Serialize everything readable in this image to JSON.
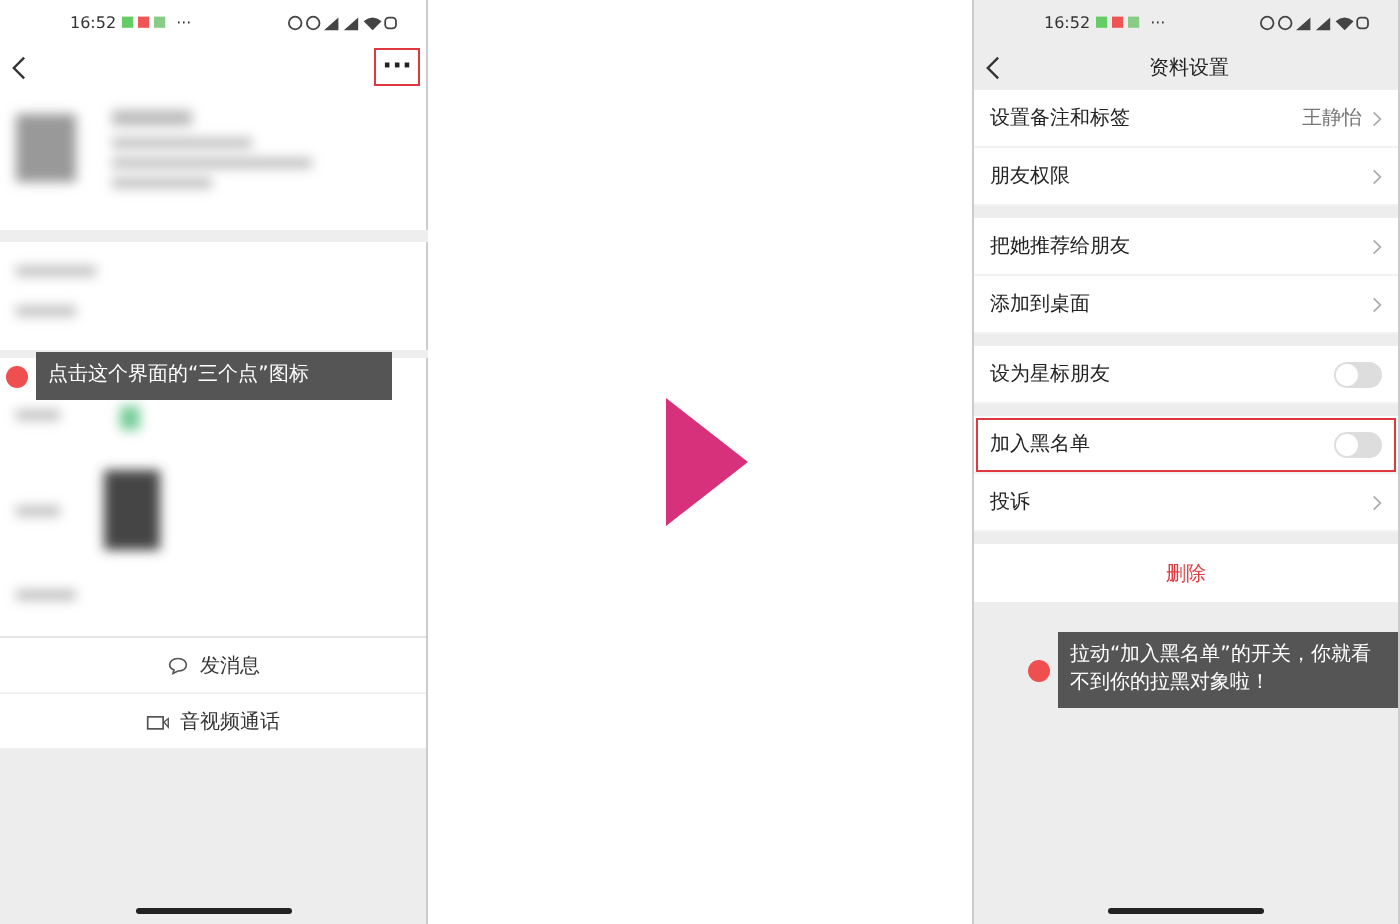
{
  "left_phone": {
    "status_bar": {
      "time": "16:52",
      "more": "···"
    },
    "more_button": {
      "label": "···",
      "highlighted": true
    },
    "tip": {
      "text": "点击这个界面的“三个点”图标"
    },
    "actions": [
      {
        "label": "发消息",
        "kind": "message"
      },
      {
        "label": "音视频通话",
        "kind": "video"
      }
    ]
  },
  "right_phone": {
    "status_bar": {
      "time": "16:52",
      "more": "···"
    },
    "title": "资料设置",
    "groups": [
      [
        {
          "label": "设置备注和标签",
          "kind": "link",
          "value": "王静怡",
          "highlighted": false
        },
        {
          "label": "朋友权限",
          "kind": "link",
          "highlighted": false
        }
      ],
      [
        {
          "label": "把她推荐给朋友",
          "kind": "link",
          "highlighted": false
        },
        {
          "label": "添加到桌面",
          "kind": "link",
          "highlighted": false
        }
      ],
      [
        {
          "label": "设为星标朋友",
          "kind": "toggle",
          "on": false,
          "highlighted": false
        }
      ],
      [
        {
          "label": "加入黑名单",
          "kind": "toggle",
          "on": false,
          "highlighted": true
        },
        {
          "label": "投诉",
          "kind": "link",
          "highlighted": false
        }
      ]
    ],
    "delete_button": {
      "label": "删除"
    },
    "tip": {
      "text": "拉动“加入黑名单”的开关，你就看不到你的拉黑对象啦！"
    }
  }
}
